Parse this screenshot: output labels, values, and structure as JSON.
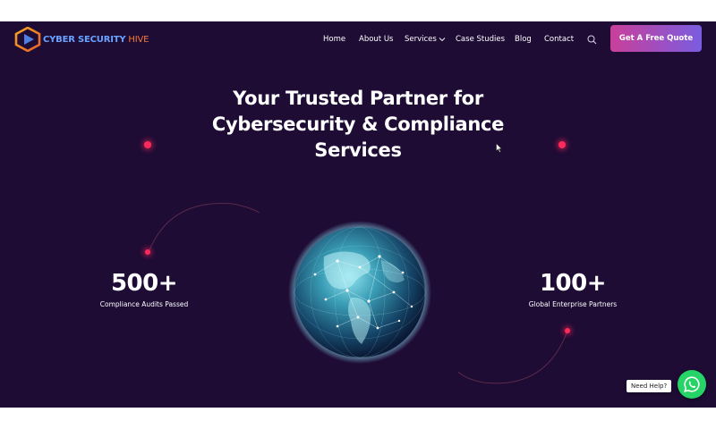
{
  "brand": {
    "name_bold": "CYBER SECURITY",
    "name_light": "HIVE",
    "logo_icon": "hexagon-play-logo",
    "primary_color": "#6aa2ff",
    "accent_color": "#f07a3a"
  },
  "nav": {
    "items": [
      {
        "label": "Home"
      },
      {
        "label": "About Us"
      },
      {
        "label": "Services",
        "has_dropdown": true
      },
      {
        "label": "Case Studies"
      },
      {
        "label": "Blog"
      },
      {
        "label": "Contact"
      }
    ],
    "search_icon": "search-icon",
    "cta_label": "Get A Free Quote"
  },
  "hero": {
    "headline_line1": "Your Trusted Partner for",
    "headline_line2": "Cybersecurity & Compliance",
    "headline_line3": "Services",
    "background_color": "#1e0c35",
    "globe_icon": "globe-network"
  },
  "stats": [
    {
      "value": "500+",
      "label": "Compliance Audits Passed"
    },
    {
      "value": "100+",
      "label": "Global Enterprise Partners"
    }
  ],
  "help": {
    "bubble_text": "Need Help?",
    "chat_icon": "whatsapp-icon",
    "chat_color": "#25d366"
  }
}
